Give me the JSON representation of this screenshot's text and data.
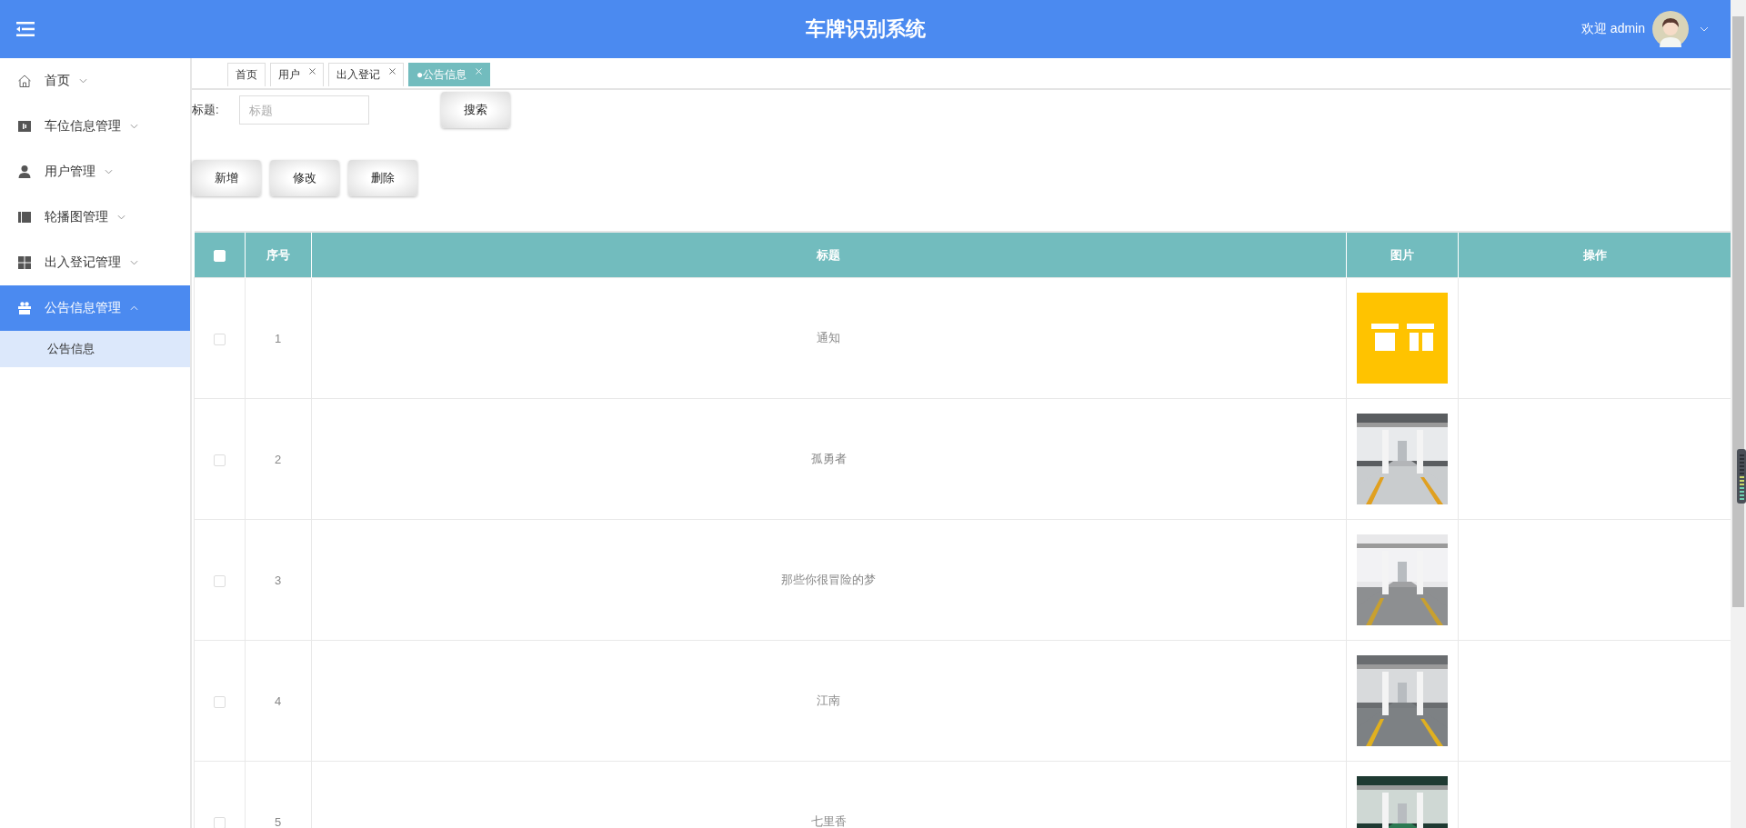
{
  "header": {
    "title": "车牌识别系统",
    "welcome": "欢迎 admin"
  },
  "sidebar": {
    "items": [
      {
        "label": "首页",
        "expanded": false,
        "selected": false
      },
      {
        "label": "车位信息管理",
        "expanded": false,
        "selected": false
      },
      {
        "label": "用户管理",
        "expanded": false,
        "selected": false
      },
      {
        "label": "轮播图管理",
        "expanded": false,
        "selected": false
      },
      {
        "label": "出入登记管理",
        "expanded": false,
        "selected": false
      },
      {
        "label": "公告信息管理",
        "expanded": true,
        "selected": true,
        "children": [
          {
            "label": "公告信息",
            "selected": true
          }
        ]
      }
    ]
  },
  "tabs": [
    {
      "label": "首页",
      "closable": false,
      "selected": false
    },
    {
      "label": "用户",
      "closable": true,
      "selected": false
    },
    {
      "label": "出入登记",
      "closable": true,
      "selected": false
    },
    {
      "label": "●公告信息",
      "closable": true,
      "selected": true
    }
  ],
  "search": {
    "label": "标题:",
    "placeholder": "标题",
    "button": "搜索"
  },
  "actions": [
    "新增",
    "修改",
    "删除"
  ],
  "table": {
    "select_all": {
      "checked": false
    },
    "columns": [
      "序号",
      "标题",
      "图片",
      "操作"
    ],
    "rows": [
      {
        "checked": false,
        "number": "1",
        "title": "通知"
      },
      {
        "checked": false,
        "number": "2",
        "title": "孤勇者"
      },
      {
        "checked": false,
        "number": "3",
        "title": "那些你很冒险的梦"
      },
      {
        "checked": false,
        "number": "4",
        "title": "江南"
      },
      {
        "checked": false,
        "number": "5",
        "title": "七里香"
      }
    ]
  }
}
